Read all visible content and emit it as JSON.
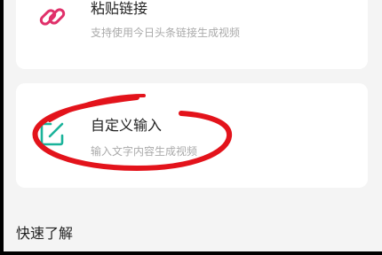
{
  "options": [
    {
      "title": "粘贴链接",
      "subtitle": "支持使用今日头条链接生成视频",
      "icon": "link-icon"
    },
    {
      "title": "自定义输入",
      "subtitle": "输入文字内容生成视频",
      "icon": "edit-icon"
    }
  ],
  "section": {
    "title": "快速了解"
  },
  "colors": {
    "page_background": "#f4f4f4",
    "card_background": "#ffffff",
    "icon_pink": "#e0306a",
    "icon_teal": "#1ab39a",
    "annotation_red": "#e3131b"
  }
}
